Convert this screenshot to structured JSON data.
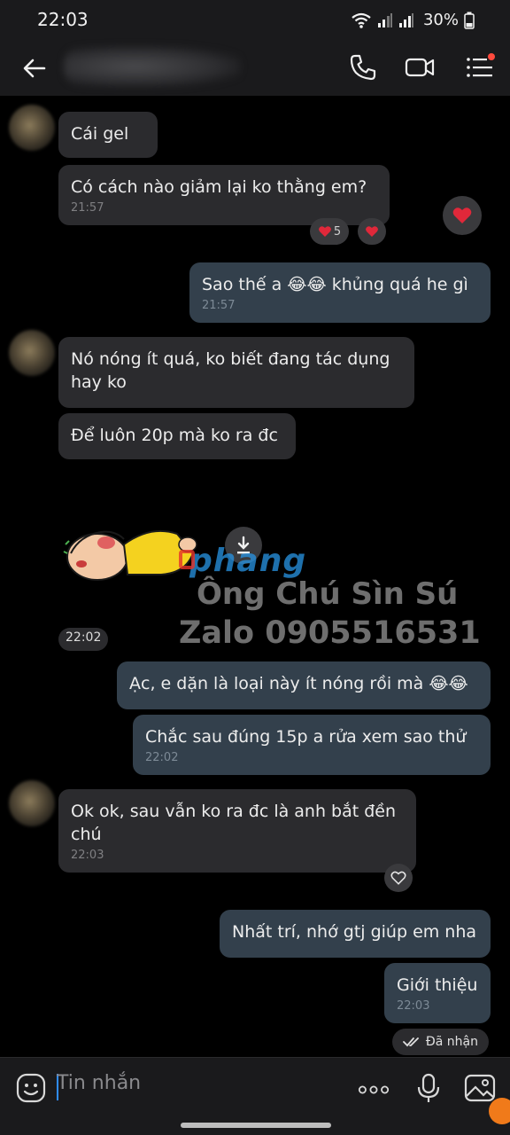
{
  "status_bar": {
    "time": "22:03",
    "battery": "30%"
  },
  "header": {
    "contact_name": ""
  },
  "messages": [
    {
      "id": "m1",
      "direction": "in",
      "text": "Cái gel"
    },
    {
      "id": "m2",
      "direction": "in",
      "text": "Có cách nào giảm lại ko thằng em?",
      "time": "21:57",
      "reaction_count": "5"
    },
    {
      "id": "m3",
      "direction": "out",
      "text": "Sao thế a 😂😂 khủng quá he gì",
      "time": "21:57"
    },
    {
      "id": "m4",
      "direction": "in",
      "text_lines": [
        "Nó nóng ít quá, ko biết đang tác dụng",
        "hay ko"
      ]
    },
    {
      "id": "m5",
      "direction": "in",
      "text": "Để luôn 20p mà ko ra đc"
    },
    {
      "id": "m6",
      "direction": "in",
      "type": "sticker",
      "time": "22:02"
    },
    {
      "id": "m7",
      "direction": "out",
      "text": "Ạc, e dặn là loại này ít nóng rồi mà 😂😂"
    },
    {
      "id": "m8",
      "direction": "out",
      "text": "Chắc sau đúng 15p a rửa xem sao thử",
      "time": "22:02"
    },
    {
      "id": "m9",
      "direction": "in",
      "text_lines": [
        "Ok ok, sau vẫn ko ra đc là anh bắt đền",
        "chú"
      ],
      "time": "22:03"
    },
    {
      "id": "m10",
      "direction": "out",
      "text": "Nhất trí, nhớ gtj giúp em nha"
    },
    {
      "id": "m11",
      "direction": "out",
      "text": "Giới thiệu",
      "time": "22:03"
    }
  ],
  "delivery_status": "Đã nhận",
  "watermark": {
    "brand": "phang",
    "line1": "Ông Chú Sìn Sú",
    "line2": "Zalo 0905516531"
  },
  "input": {
    "placeholder": "Tin nhắn"
  },
  "colors": {
    "incoming_bubble": "#2b2b2e",
    "outgoing_bubble": "#33404c",
    "heart": "#e0283a",
    "accent": "#2f8cff"
  },
  "icons": [
    "back-arrow-icon",
    "phone-icon",
    "video-call-icon",
    "menu-icon",
    "heart-icon",
    "download-icon",
    "emoji-icon",
    "more-dots-icon",
    "microphone-icon",
    "image-icon",
    "double-check-icon"
  ]
}
